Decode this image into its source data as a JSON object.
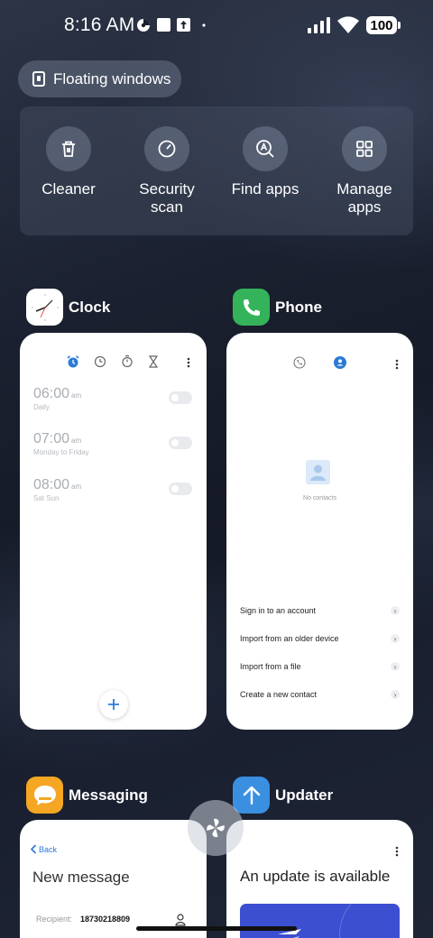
{
  "status_bar": {
    "time": "8:16 AM",
    "battery": "100"
  },
  "floating_windows": {
    "label": "Floating windows"
  },
  "tools": [
    {
      "label": "Cleaner",
      "icon": "trash-icon"
    },
    {
      "label": "Security\nscan",
      "icon": "security-gauge-icon"
    },
    {
      "label": "Find apps",
      "icon": "find-apps-icon"
    },
    {
      "label": "Manage\napps",
      "icon": "grid-icon"
    }
  ],
  "clock_app": {
    "name": "Clock",
    "alarms": [
      {
        "time": "06:00",
        "ampm": "am",
        "repeat": "Daily"
      },
      {
        "time": "07:00",
        "ampm": "am",
        "repeat": "Monday to Friday"
      },
      {
        "time": "08:00",
        "ampm": "am",
        "repeat": "Sat Sun"
      }
    ],
    "accent": "#2b7bd6"
  },
  "phone_app": {
    "name": "Phone",
    "empty_text": "No contacts",
    "actions": [
      "Sign in to an account",
      "Import from an older device",
      "Import from a file",
      "Create a new contact"
    ],
    "accent": "#34b35b"
  },
  "messaging_app": {
    "name": "Messaging",
    "back_label": "Back",
    "title": "New message",
    "recipient_label": "Recipient:",
    "recipient_value": "18730218809",
    "accent": "#f5a623"
  },
  "updater_app": {
    "name": "Updater",
    "title": "An update is available",
    "accent": "#3b8fe0"
  }
}
